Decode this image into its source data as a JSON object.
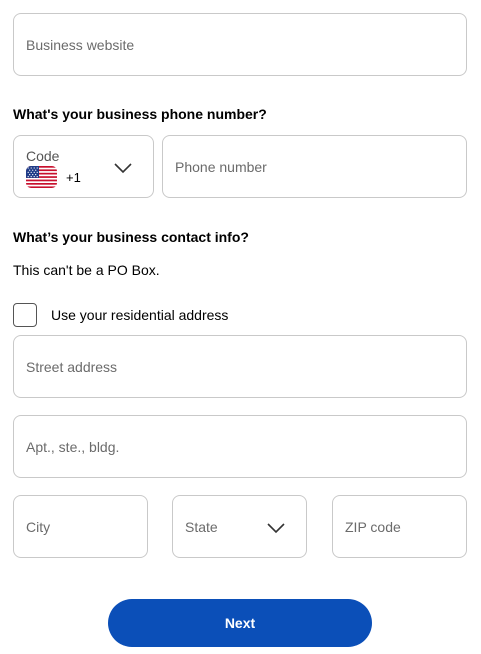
{
  "fields": {
    "business_website": {
      "placeholder": "Business website"
    },
    "phone_number": {
      "placeholder": "Phone number"
    },
    "street_address": {
      "placeholder": "Street address"
    },
    "apt": {
      "placeholder": "Apt., ste., bldg."
    },
    "city": {
      "placeholder": "City"
    },
    "state": {
      "placeholder": "State"
    },
    "zip": {
      "placeholder": "ZIP code"
    }
  },
  "phone_section": {
    "heading": "What's your business phone number?",
    "code_label": "Code",
    "country_flag_icon": "us-flag-icon",
    "dial_code": "+1"
  },
  "contact_section": {
    "heading": "What’s your business contact info?",
    "note": "This can't be a PO Box.",
    "residential_checkbox_label": "Use your residential address",
    "residential_checked": false
  },
  "actions": {
    "next_label": "Next"
  },
  "colors": {
    "primary": "#0b4fb8",
    "border": "#c9c9c9",
    "placeholder": "#6b6b6b"
  }
}
